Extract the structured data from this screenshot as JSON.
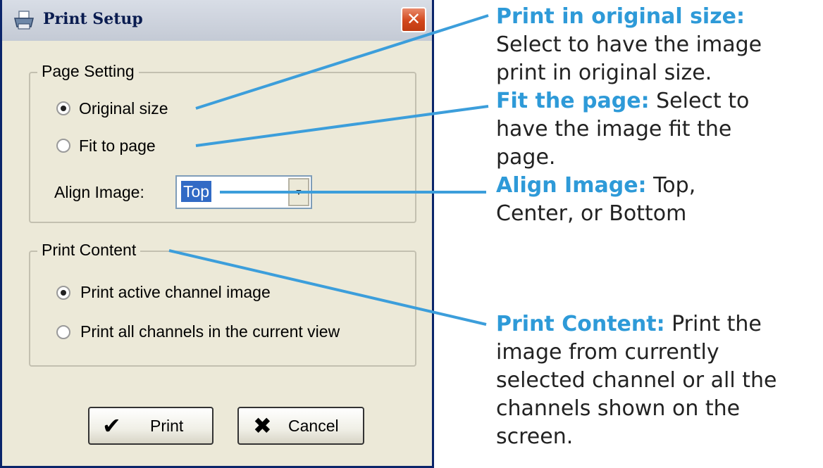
{
  "dialog": {
    "title": "Print Setup",
    "close_symbol": "✕",
    "page_setting": {
      "legend": "Page Setting",
      "options": [
        {
          "label": "Original size",
          "checked": true
        },
        {
          "label": "Fit to page",
          "checked": false
        }
      ],
      "align_label": "Align Image:",
      "align_value": "Top"
    },
    "print_content": {
      "legend": "Print Content",
      "options": [
        {
          "label": "Print active channel image",
          "checked": true
        },
        {
          "label": "Print all channels in the current view",
          "checked": false
        }
      ]
    },
    "buttons": {
      "print": "Print",
      "cancel": "Cancel"
    },
    "icons": {
      "title": "printer-icon",
      "print": "checkmark-icon",
      "cancel": "x-icon"
    }
  },
  "annotations": [
    {
      "term": "Print in original size:",
      "lines": [
        "Select to have the image",
        "print in original size."
      ]
    },
    {
      "term": "Fit the page:",
      "lines": [
        " Select to",
        "have the image fit the",
        "page."
      ]
    },
    {
      "term": "Align Image:",
      "lines": [
        " Top,",
        "Center, or Bottom"
      ]
    },
    {
      "term": "Print Content:",
      "lines": [
        " Print the",
        "image from currently",
        "selected channel or all the",
        "channels shown on the",
        "screen."
      ]
    }
  ],
  "colors": {
    "callout": "#2e9ad8",
    "dialog_bg": "#ece9d8",
    "close_button": "#d2471c",
    "selection": "#316ac5"
  }
}
